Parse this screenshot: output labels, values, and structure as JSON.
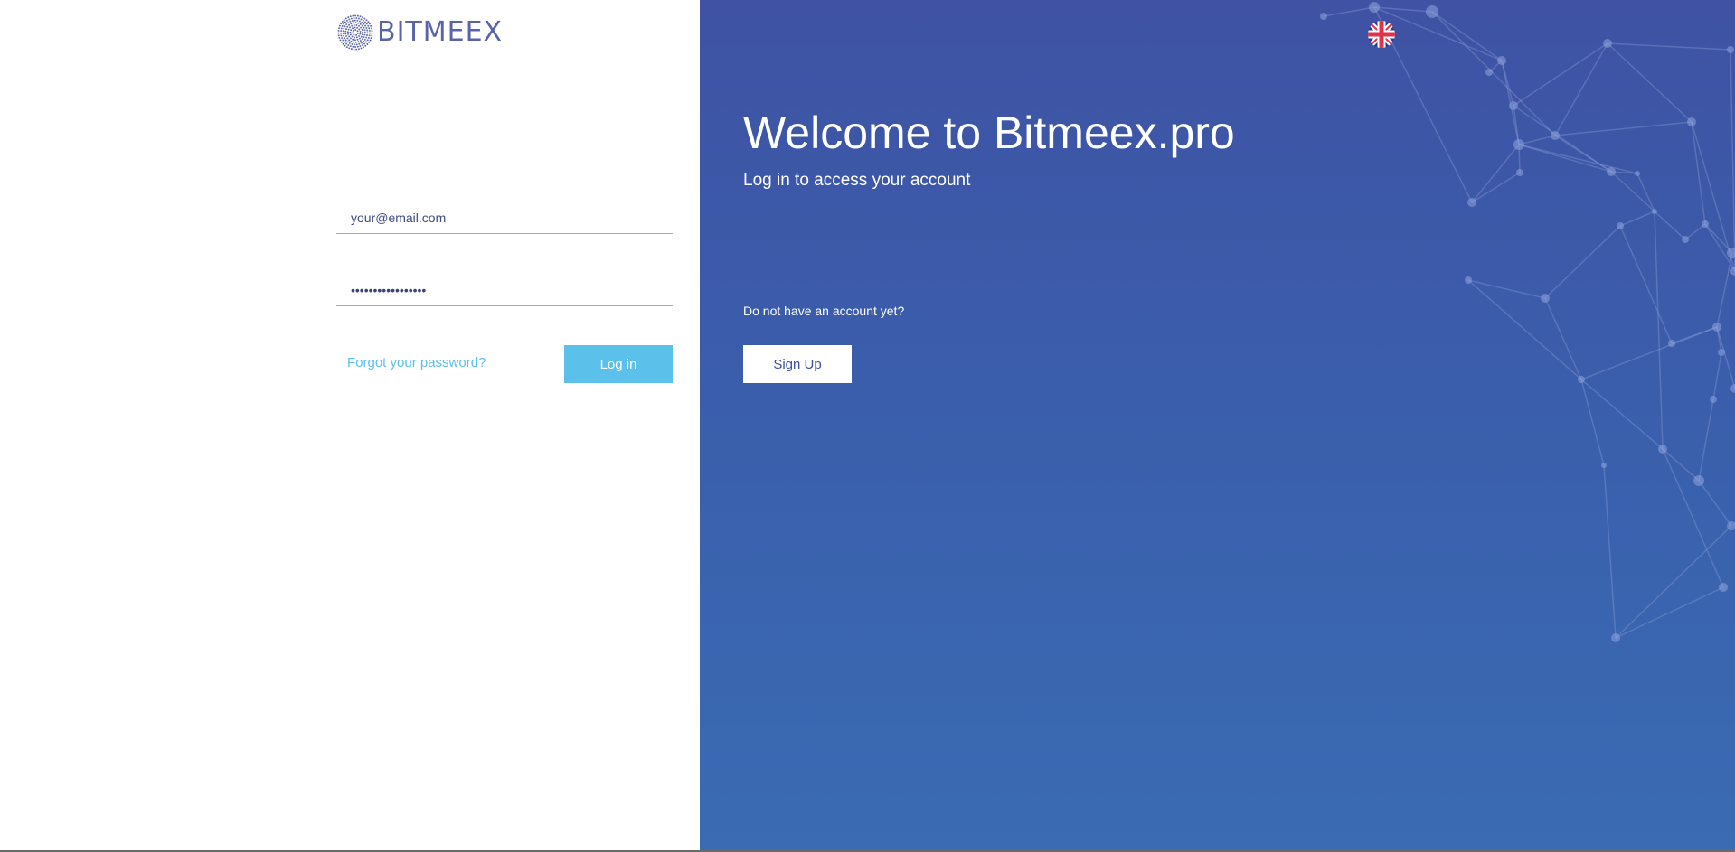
{
  "brand": {
    "logo_text": "BITMEEX",
    "logo_icon": "globe-dots-icon"
  },
  "login_form": {
    "email_placeholder": "your@email.com",
    "password_value": "•••••••••••••••••",
    "forgot_password_label": "Forgot your password?",
    "login_button_label": "Log in"
  },
  "welcome": {
    "title": "Welcome to Bitmeex.pro",
    "subtitle": "Log in to access your account",
    "no_account_text": "Do not have an account yet?",
    "signup_button_label": "Sign Up"
  },
  "language": {
    "icon": "uk-flag-icon"
  },
  "colors": {
    "accent_blue": "#5bc0ea",
    "panel_gradient_top": "#3f52a4",
    "panel_gradient_bottom": "#3a6bb3",
    "logo_color": "#5964a8"
  }
}
